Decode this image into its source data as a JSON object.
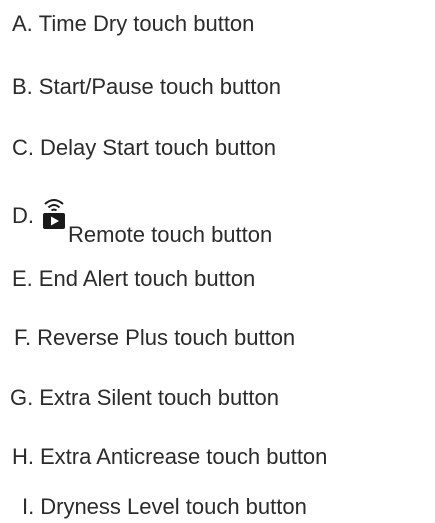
{
  "items": [
    {
      "letter": "A.",
      "label": "Time Dry touch button"
    },
    {
      "letter": "B.",
      "label": "Start/Pause touch button"
    },
    {
      "letter": "C.",
      "label": "Delay Start touch button"
    },
    {
      "letter": "D.",
      "label": "Remote touch button",
      "icon": "wifi-remote-icon"
    },
    {
      "letter": "E.",
      "label": "End Alert touch button"
    },
    {
      "letter": "F.",
      "label": "Reverse Plus touch button"
    },
    {
      "letter": "G.",
      "label": "Extra Silent touch button"
    },
    {
      "letter": "H.",
      "label": "Extra Anticrease touch button"
    },
    {
      "letter": "I.",
      "label": "Dryness Level touch button"
    }
  ],
  "colors": {
    "text": "#2b2b2b",
    "icon": "#1a1a1a"
  }
}
